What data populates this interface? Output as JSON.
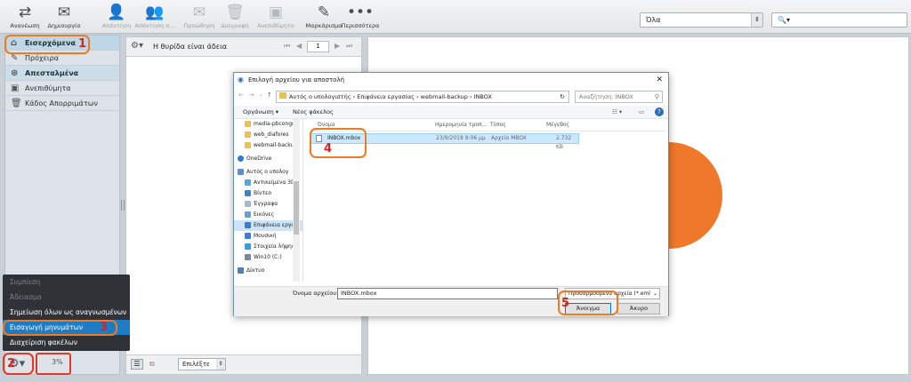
{
  "toolbar": {
    "buttons": [
      {
        "label": "Ανανέωση",
        "icon": "refresh-icon"
      },
      {
        "label": "Δημιουργία",
        "icon": "compose-icon"
      },
      {
        "label": "Απάντηση",
        "icon": "reply-icon"
      },
      {
        "label": "Απάντηση σ...",
        "icon": "reply-all-icon"
      },
      {
        "label": "Προώθηση",
        "icon": "forward-icon"
      },
      {
        "label": "Διαγραφή",
        "icon": "trash-icon"
      },
      {
        "label": "Ανεπιθύμητο",
        "icon": "junk-icon"
      },
      {
        "label": "Μαρκάρισμα",
        "icon": "pencil-icon"
      },
      {
        "label": "Περισσότερα",
        "icon": "more-icon"
      }
    ],
    "filter_value": "Όλα",
    "search_placeholder": ""
  },
  "folders": [
    {
      "label": "Εισερχόμενα",
      "icon": "inbox-icon"
    },
    {
      "label": "Πρόχειρα",
      "icon": "pencil-icon"
    },
    {
      "label": "Απεσταλμένα",
      "icon": "sent-icon"
    },
    {
      "label": "Ανεπιθύμητα",
      "icon": "junk-icon"
    },
    {
      "label": "Κάδος Απορριμάτων",
      "icon": "trash-icon"
    }
  ],
  "annotations": {
    "n1": "1",
    "n2": "2",
    "n3": "3",
    "n4": "4",
    "n5": "5"
  },
  "message_list": {
    "empty_text": "Η θυρίδα είναι άδεια",
    "page": "1",
    "select_label": "Επιλέξτε"
  },
  "context_menu": [
    {
      "label": "Συμπίεση",
      "enabled": false
    },
    {
      "label": "Άδειασμα",
      "enabled": false
    },
    {
      "label": "Σημείωση όλων ως αναγνωσμένων",
      "enabled": true
    },
    {
      "label": "Εισαγωγή μηνυμάτων",
      "enabled": true
    },
    {
      "label": "Διαχείριση φακέλων",
      "enabled": true
    }
  ],
  "footer": {
    "quota": "3%"
  },
  "dialog": {
    "title": "Επιλογή αρχείου για αποστολή",
    "breadcrumb": [
      "Αυτός ο υπολογιστής",
      "Επιφάνεια εργασίας",
      "webmail-backup",
      "INBOX"
    ],
    "search_placeholder": "Αναζήτηση: INBOX",
    "organize": "Οργάνωση",
    "new_folder": "Νέος φάκελος",
    "nav": [
      "media-pbcongr",
      "web_diafores",
      "webmail-backup",
      "OneDrive",
      "Αυτός ο υπολογ",
      "Αντικείμενα 3D",
      "Βίντεο",
      "Έγγραφα",
      "Εικόνες",
      "Επιφάνεια εργασ",
      "Μουσική",
      "Στοιχεία λήψης",
      "Win10 (C:)",
      "Δίκτυο"
    ],
    "columns": [
      "Όνομα",
      "Ημερομηνία τροπ...",
      "Τύπος",
      "Μέγεθος"
    ],
    "file": {
      "name": "INBOX.mbox",
      "date": "23/9/2018 9:06 μμ",
      "type": "Αρχείο MBOX",
      "size": "2.732 KB"
    },
    "filename_label": "Όνομα αρχείου:",
    "filename_value": "INBOX.mbox",
    "filetype": "Προσαρμοσμένα αρχεία (*.eml",
    "open": "Άνοιγμα",
    "cancel": "Άκυρο"
  }
}
